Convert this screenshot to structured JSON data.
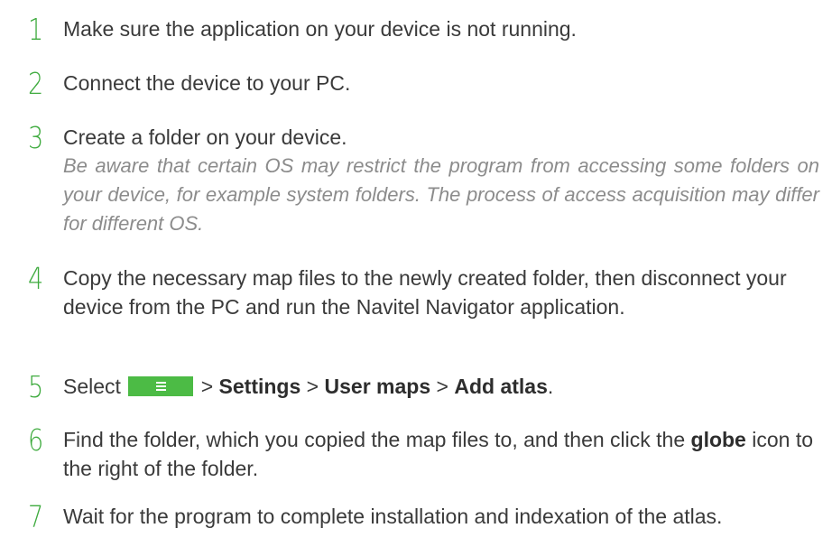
{
  "steps": [
    {
      "number": "1",
      "text": "Make sure the application on your device is not running."
    },
    {
      "number": "2",
      "text": "Connect the device to your PC."
    },
    {
      "number": "3",
      "text": "Create a folder on your device.",
      "note": "Be aware that certain OS may restrict the program from accessing some folders on your device, for example system folders. The process of access acquisition may differ for different OS."
    },
    {
      "number": "4",
      "text": "Copy the necessary map files to the newly created folder, then disconnect your device from the PC and run the Navitel Navigator application."
    },
    {
      "number": "5",
      "select": "Select",
      "sep1": ">",
      "settings": "Settings",
      "sep2": ">",
      "user_maps": "User maps",
      "sep3": ">",
      "add_atlas": "Add atlas",
      "end": ".",
      "menu_icon": "menu-icon",
      "menu_color": "#4cbb45"
    },
    {
      "number": "6",
      "part1": "Find the folder, which you copied the map files to, and then click the",
      "globe": "globe",
      "part2": "icon to the right of the folder."
    },
    {
      "number": "7",
      "text": "Wait for the program to complete installation and indexation of the atlas."
    }
  ],
  "colors": {
    "accent": "#3fab3f",
    "text": "#3a3a3a",
    "note": "#8c8c8c"
  }
}
